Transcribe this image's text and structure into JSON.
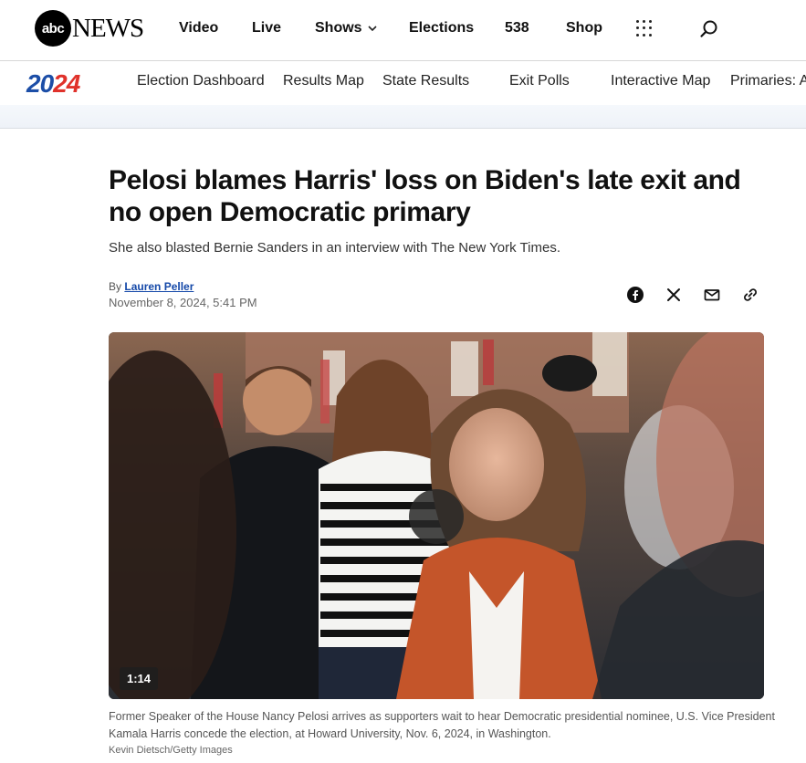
{
  "brand": {
    "logo_circle": "abc",
    "logo_word": "NEWS"
  },
  "topnav": {
    "items": [
      "Video",
      "Live",
      "Shows",
      "Elections",
      "538",
      "Shop"
    ]
  },
  "election_logo": {
    "part1": "20",
    "part2": "24"
  },
  "subnav": {
    "items": [
      "Election Dashboard",
      "Results Map",
      "State Results",
      "Exit Polls",
      "Interactive Map",
      "Primaries: A"
    ]
  },
  "article": {
    "headline": "Pelosi blames Harris' loss on Biden's late exit and no open Democratic primary",
    "dek": "She also blasted Bernie Sanders in an interview with The New York Times.",
    "byline_prefix": "By",
    "author": "Lauren Peller",
    "timestamp": "November 8, 2024, 5:41 PM"
  },
  "share": [
    "facebook-icon",
    "x-icon",
    "email-icon",
    "link-icon"
  ],
  "media": {
    "duration": "1:14",
    "caption": "Former Speaker of the House Nancy Pelosi arrives as supporters wait to hear Democratic presidential nominee, U.S. Vice President Kamala Harris concede the election, at Howard University, Nov. 6, 2024, in Washington.",
    "credit": "Kevin Dietsch/Getty Images"
  },
  "colors": {
    "accent_blue": "#1c4ea7",
    "accent_red": "#e0322b",
    "link": "#1448a8"
  }
}
